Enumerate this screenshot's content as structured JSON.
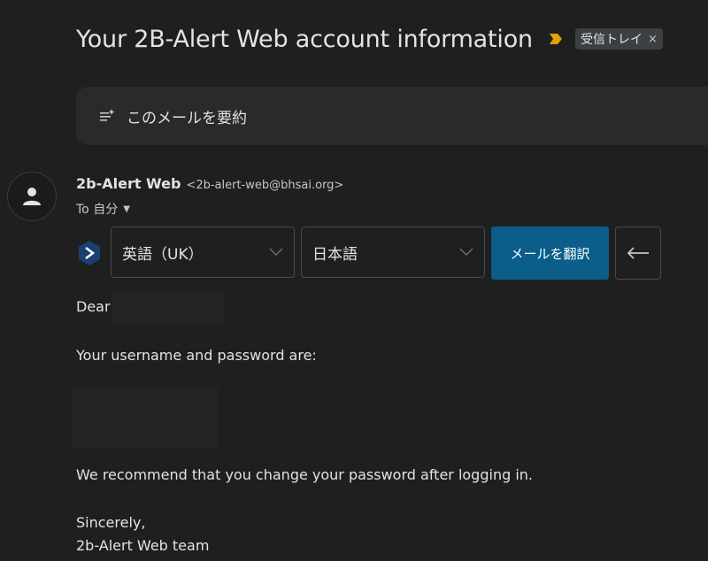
{
  "subject": {
    "title": "Your 2B-Alert Web account information",
    "label": "受信トレイ",
    "label_close": "×",
    "importance_color": "#e3a008"
  },
  "summary": {
    "text": "このメールを要約",
    "icon": "summarize-sparkle-icon"
  },
  "sender": {
    "name": "2b-Alert Web",
    "email": "<2b-alert-web@bhsai.org>",
    "to_label": "To 自分",
    "avatar_icon": "person-icon"
  },
  "translate": {
    "logo_icon": "translator-logo-icon",
    "source_language": "英語（UK）",
    "target_language": "日本語",
    "translate_button": "メールを翻訳",
    "back_icon": "arrow-left-icon"
  },
  "body": {
    "greeting": "Dear",
    "line1": "Your username and password are:",
    "line2": "We recommend that you change your password after logging in.",
    "closing": "Sincerely,",
    "signature": "2b-Alert Web team"
  },
  "colors": {
    "background": "#1f1f1f",
    "summary_background": "#282a2c",
    "translate_button": "#0b5d8a",
    "text": "#e3e3e3"
  }
}
